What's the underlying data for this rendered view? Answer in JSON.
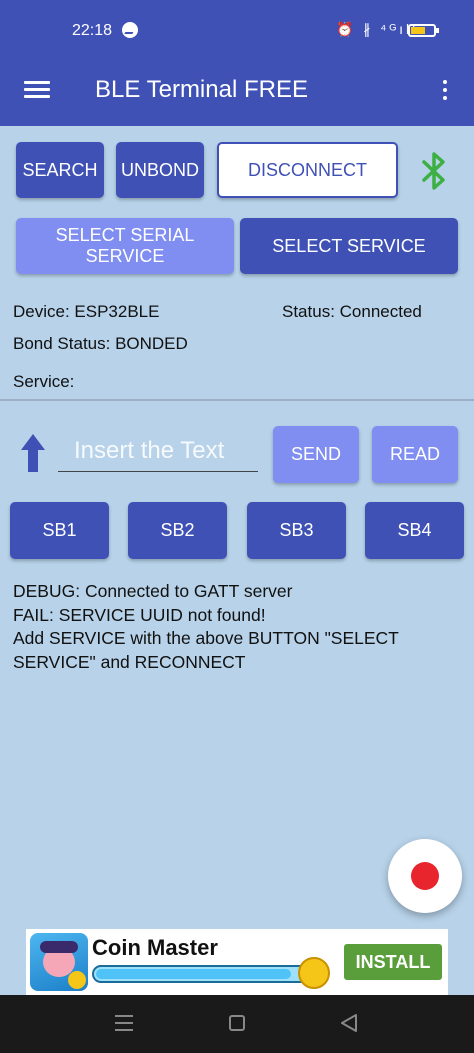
{
  "statusbar": {
    "time": "22:18",
    "system_icons": "⏰ ∦ ⁴ᴳıll"
  },
  "appbar": {
    "title": "BLE Terminal FREE"
  },
  "buttons": {
    "search": "SEARCH",
    "unbond": "UNBOND",
    "disconnect": "DISCONNECT",
    "select_serial_service": "SELECT SERIAL SERVICE",
    "select_service": "SELECT SERVICE",
    "send": "SEND",
    "read": "READ",
    "sb1": "SB1",
    "sb2": "SB2",
    "sb3": "SB3",
    "sb4": "SB4"
  },
  "info": {
    "device": "Device: ESP32BLE",
    "status": "Status: Connected",
    "bond_status": "Bond Status: BONDED",
    "service": "Service:"
  },
  "input": {
    "placeholder": "Insert the Text",
    "value": ""
  },
  "log": {
    "lines": [
      "DEBUG: Connected to GATT server",
      "FAIL: SERVICE UUID not found!",
      "Add SERVICE with the above BUTTON \"SELECT SERVICE\" and RECONNECT"
    ]
  },
  "ad": {
    "title": "Coin Master",
    "install": "INSTALL",
    "progress": 0.92
  },
  "colors": {
    "primary": "#3f51b5",
    "light_button": "#7f8ef0",
    "background": "#b7d2e9",
    "bluetooth_icon": "#3cb043",
    "record": "#e8242c",
    "install": "#5a9e3c"
  }
}
